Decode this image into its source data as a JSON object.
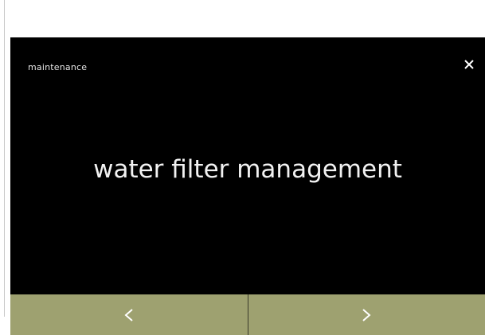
{
  "header": {
    "title": "maintenance",
    "close_icon": "close-icon"
  },
  "main": {
    "label": "water filter management"
  },
  "navigation": {
    "previous_icon": "chevron-left-icon",
    "next_icon": "chevron-right-icon"
  },
  "colors": {
    "screen_background": "#000000",
    "nav_bar": "#9ea170",
    "text": "#f2f2f2"
  }
}
